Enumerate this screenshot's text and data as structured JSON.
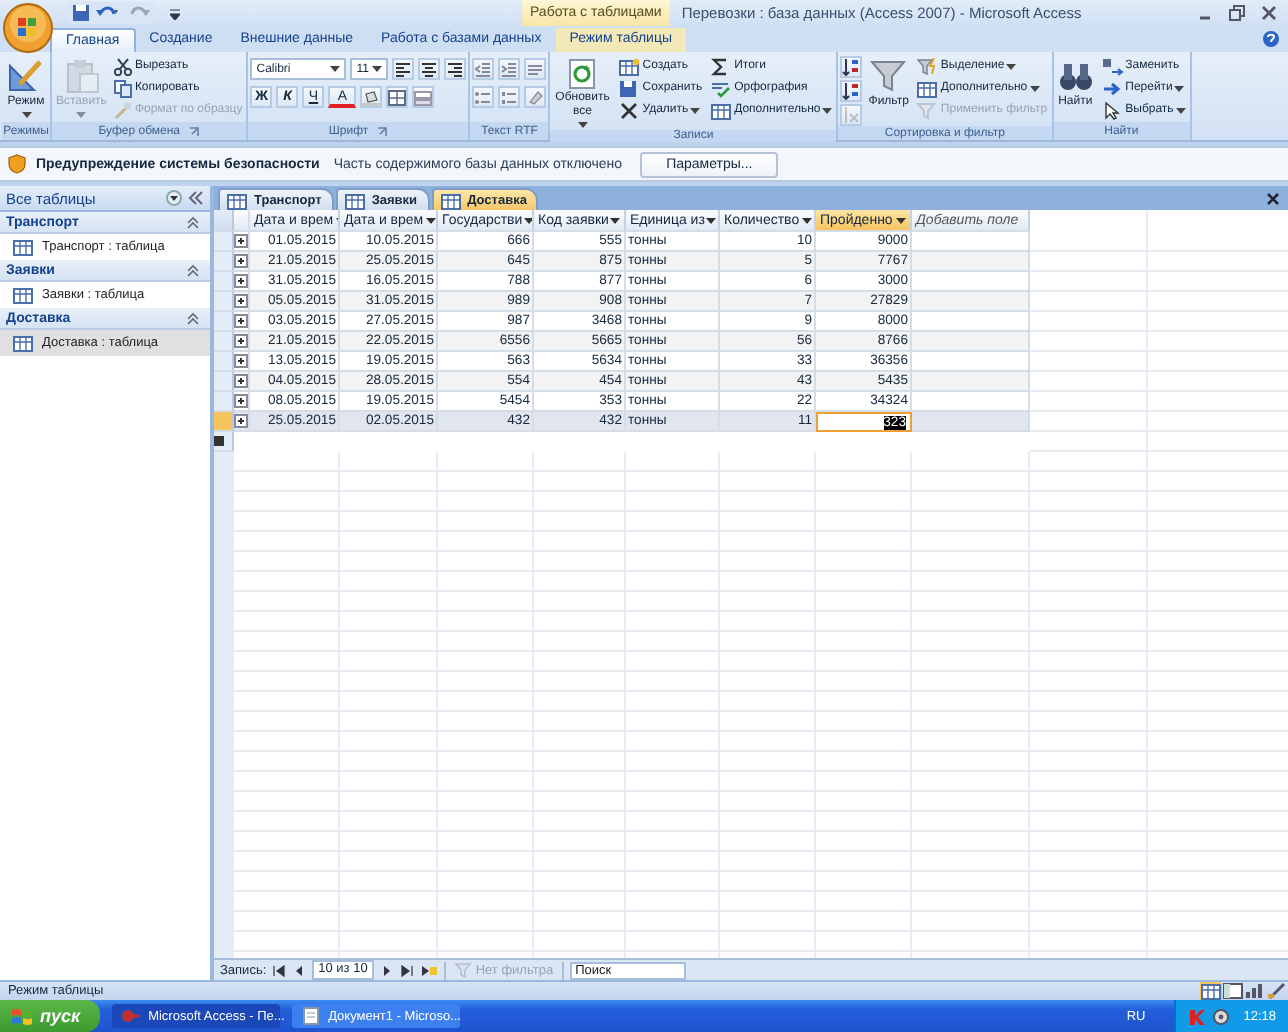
{
  "title_bar": {
    "contextual_tab": "Работа с таблицами",
    "title": "Перевозки : база данных (Access 2007) - Microsoft Access"
  },
  "ribbon_tabs": [
    {
      "label": "Главная",
      "selected": true,
      "contextual": false
    },
    {
      "label": "Создание",
      "selected": false,
      "contextual": false
    },
    {
      "label": "Внешние данные",
      "selected": false,
      "contextual": false
    },
    {
      "label": "Работа с базами данных",
      "selected": false,
      "contextual": false
    },
    {
      "label": "Режим таблицы",
      "selected": false,
      "contextual": true
    }
  ],
  "ribbon_groups": [
    {
      "label": "Режимы",
      "launcher": false,
      "items": [
        {
          "kind": "large",
          "label": "Режим",
          "dropdown": true,
          "disabled": false
        }
      ]
    },
    {
      "label": "Буфер обмена",
      "launcher": true,
      "items": [
        {
          "kind": "large",
          "label": "Вставить",
          "dropdown": true,
          "disabled": true
        },
        {
          "kind": "small",
          "label": "Вырезать",
          "dropdown": false,
          "disabled": false
        },
        {
          "kind": "small",
          "label": "Копировать",
          "dropdown": false,
          "disabled": false
        },
        {
          "kind": "small",
          "label": "Формат по образцу",
          "dropdown": false,
          "disabled": true
        }
      ]
    },
    {
      "label": "Шрифт",
      "launcher": true,
      "strips": [
        [
          {
            "kind": "combo",
            "value": "Calibri"
          },
          {
            "kind": "combo",
            "value": "11"
          },
          {
            "kind": "icon"
          },
          {
            "kind": "icon"
          },
          {
            "kind": "icon"
          }
        ],
        [
          {
            "kind": "bold",
            "label": "Ж"
          },
          {
            "kind": "italic",
            "label": "К"
          },
          {
            "kind": "underline",
            "label": "Ч"
          },
          {
            "kind": "color",
            "label": "A"
          },
          {
            "kind": "icon"
          },
          {
            "kind": "icon"
          },
          {
            "kind": "icon"
          }
        ]
      ]
    },
    {
      "label": "Текст RTF",
      "launcher": false,
      "strips": [
        [
          {
            "kind": "icon"
          },
          {
            "kind": "icon"
          },
          {
            "kind": "icon"
          }
        ],
        [
          {
            "kind": "icon"
          },
          {
            "kind": "icon"
          },
          {
            "kind": "icon"
          }
        ]
      ]
    },
    {
      "label": "Записи",
      "launcher": false,
      "items": [
        {
          "kind": "large",
          "label": "Обновить все",
          "dropdown": true,
          "disabled": false
        },
        {
          "kind": "small",
          "label": "Создать",
          "dropdown": false,
          "disabled": false
        },
        {
          "kind": "small",
          "label": "Сохранить",
          "dropdown": false,
          "disabled": false
        },
        {
          "kind": "small",
          "label": "Удалить",
          "dropdown": true,
          "disabled": false
        },
        {
          "kind": "small",
          "label": "Итоги",
          "dropdown": false,
          "disabled": false
        },
        {
          "kind": "small",
          "label": "Орфография",
          "dropdown": false,
          "disabled": false
        },
        {
          "kind": "small",
          "label": "Дополнительно",
          "dropdown": true,
          "disabled": false
        }
      ]
    },
    {
      "label": "Сортировка и фильтр",
      "launcher": false,
      "items": [
        {
          "kind": "icon",
          "disabled": false
        },
        {
          "kind": "icon",
          "disabled": false
        },
        {
          "kind": "icon",
          "disabled": true
        },
        {
          "kind": "large",
          "label": "Фильтр",
          "dropdown": false,
          "disabled": false
        },
        {
          "kind": "small",
          "label": "Выделение",
          "dropdown": true,
          "disabled": false
        },
        {
          "kind": "small",
          "label": "Дополнительно",
          "dropdown": true,
          "disabled": false
        },
        {
          "kind": "small",
          "label": "Применить фильтр",
          "dropdown": false,
          "disabled": true
        }
      ]
    },
    {
      "label": "Найти",
      "launcher": false,
      "items": [
        {
          "kind": "large",
          "label": "Найти",
          "dropdown": false,
          "disabled": false
        },
        {
          "kind": "small",
          "label": "Заменить",
          "dropdown": false,
          "disabled": false
        },
        {
          "kind": "small",
          "label": "Перейти",
          "dropdown": true,
          "disabled": false
        },
        {
          "kind": "small",
          "label": "Выбрать",
          "dropdown": true,
          "disabled": false
        }
      ]
    }
  ],
  "security_bar": {
    "title": "Предупреждение системы безопасности",
    "message": "Часть содержимого базы данных отключено",
    "button": "Параметры..."
  },
  "nav_pane": {
    "title": "Все таблицы",
    "groups": [
      {
        "label": "Транспорт",
        "items": [
          {
            "label": "Транспорт : таблица",
            "selected": false
          }
        ]
      },
      {
        "label": "Заявки",
        "items": [
          {
            "label": "Заявки : таблица",
            "selected": false
          }
        ]
      },
      {
        "label": "Доставка",
        "items": [
          {
            "label": "Доставка : таблица",
            "selected": true
          }
        ]
      }
    ]
  },
  "doc_tabs": [
    {
      "label": "Транспорт",
      "selected": false
    },
    {
      "label": "Заявки",
      "selected": false
    },
    {
      "label": "Доставка",
      "selected": true
    }
  ],
  "table": {
    "columns": [
      {
        "label": "Дата и врем",
        "kind": "number",
        "selected": false
      },
      {
        "label": "Дата и врем",
        "kind": "number",
        "selected": false
      },
      {
        "label": "Государстви",
        "kind": "number",
        "selected": false
      },
      {
        "label": "Код заявки",
        "kind": "number",
        "selected": false
      },
      {
        "label": "Единица из",
        "kind": "text",
        "selected": false
      },
      {
        "label": "Количество",
        "kind": "number",
        "selected": false
      },
      {
        "label": "Пройденно",
        "kind": "number",
        "selected": true
      },
      {
        "label": "Добавить поле",
        "kind": "add",
        "selected": false
      }
    ],
    "rows": [
      {
        "selected": false,
        "cells": [
          "01.05.2015",
          "10.05.2015",
          "666",
          "555",
          "тонны",
          "10",
          "9000"
        ]
      },
      {
        "selected": false,
        "cells": [
          "21.05.2015",
          "25.05.2015",
          "645",
          "875",
          "тонны",
          "5",
          "7767"
        ]
      },
      {
        "selected": false,
        "cells": [
          "31.05.2015",
          "16.05.2015",
          "788",
          "877",
          "тонны",
          "6",
          "3000"
        ]
      },
      {
        "selected": false,
        "cells": [
          "05.05.2015",
          "31.05.2015",
          "989",
          "908",
          "тонны",
          "7",
          "27829"
        ]
      },
      {
        "selected": false,
        "cells": [
          "03.05.2015",
          "27.05.2015",
          "987",
          "3468",
          "тонны",
          "9",
          "8000"
        ]
      },
      {
        "selected": false,
        "cells": [
          "21.05.2015",
          "22.05.2015",
          "6556",
          "5665",
          "тонны",
          "56",
          "8766"
        ]
      },
      {
        "selected": false,
        "cells": [
          "13.05.2015",
          "19.05.2015",
          "563",
          "5634",
          "тонны",
          "33",
          "36356"
        ]
      },
      {
        "selected": false,
        "cells": [
          "04.05.2015",
          "28.05.2015",
          "554",
          "454",
          "тонны",
          "43",
          "5435"
        ]
      },
      {
        "selected": false,
        "cells": [
          "08.05.2015",
          "19.05.2015",
          "5454",
          "353",
          "тонны",
          "22",
          "34324"
        ]
      },
      {
        "selected": true,
        "cells": [
          "25.05.2015",
          "02.05.2015",
          "432",
          "432",
          "тонны",
          "11",
          "323"
        ]
      }
    ]
  },
  "record_nav": {
    "label": "Запись:",
    "position": "10 из 10",
    "filter": "Нет фильтра",
    "filter_disabled": true,
    "search": {
      "placeholder": "Поиск"
    }
  },
  "status_bar": {
    "text": "Режим таблицы",
    "views": [
      {
        "selected": true
      },
      {
        "selected": false
      },
      {
        "selected": false
      },
      {
        "selected": false
      }
    ]
  },
  "taskbar": {
    "start": "пуск",
    "tasks": [
      {
        "label": "Microsoft Access - Пе...",
        "selected": true
      },
      {
        "label": "Документ1 - Microso...",
        "selected": false
      }
    ],
    "language": "RU",
    "clock": "12:18"
  }
}
